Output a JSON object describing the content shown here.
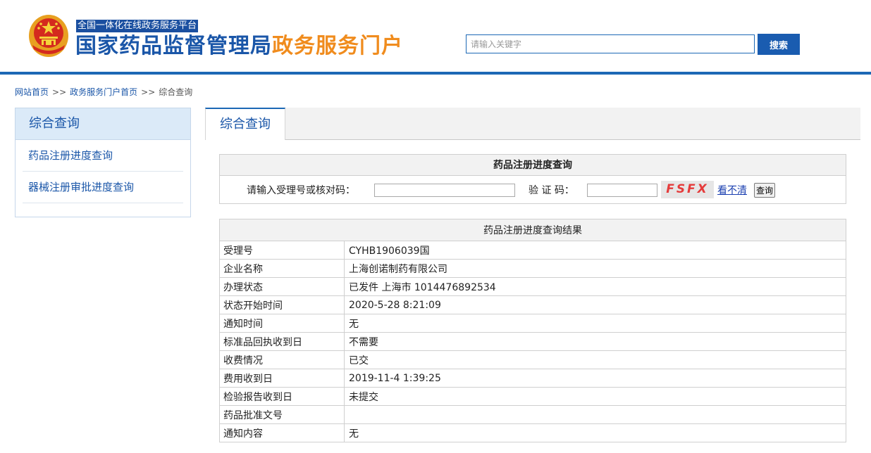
{
  "header": {
    "platform_tag": "全国一体化在线政务服务平台",
    "title_main": "国家药品监督管理局",
    "title_sub": "政务服务门户",
    "search_placeholder": "请输入关键字",
    "search_button": "搜索",
    "emblem_icon": "national-emblem-icon"
  },
  "breadcrumb": {
    "items": [
      "网站首页",
      "政务服务门户首页",
      "综合查询"
    ],
    "separator": ">>"
  },
  "sidebar": {
    "title": "综合查询",
    "items": [
      "药品注册进度查询",
      "器械注册审批进度查询"
    ]
  },
  "main": {
    "tab": "综合查询",
    "query": {
      "title": "药品注册进度查询",
      "input_label": "请输入受理号或核对码：",
      "input_value": "",
      "captcha_label": "验 证 码：",
      "captcha_value": "",
      "captcha_text": "FSFX",
      "unclear_link": "看不清",
      "submit_button": "查询"
    },
    "results": {
      "title": "药品注册进度查询结果",
      "rows": [
        {
          "key": "受理号",
          "value": "CYHB1906039国"
        },
        {
          "key": "企业名称",
          "value": "上海创诺制药有限公司"
        },
        {
          "key": "办理状态",
          "value": "已发件 上海市 1014476892534"
        },
        {
          "key": "状态开始时间",
          "value": "2020-5-28 8:21:09"
        },
        {
          "key": "通知时间",
          "value": "无"
        },
        {
          "key": "标准品回执收到日",
          "value": "不需要"
        },
        {
          "key": "收费情况",
          "value": "已交"
        },
        {
          "key": "费用收到日",
          "value": "2019-11-4 1:39:25"
        },
        {
          "key": "检验报告收到日",
          "value": "未提交"
        },
        {
          "key": "药品批准文号",
          "value": ""
        },
        {
          "key": "通知内容",
          "value": "无"
        }
      ]
    }
  },
  "colors": {
    "brand_blue": "#1a56a8",
    "accent_orange": "#f08c1e",
    "captcha_red": "#e53b3b"
  }
}
